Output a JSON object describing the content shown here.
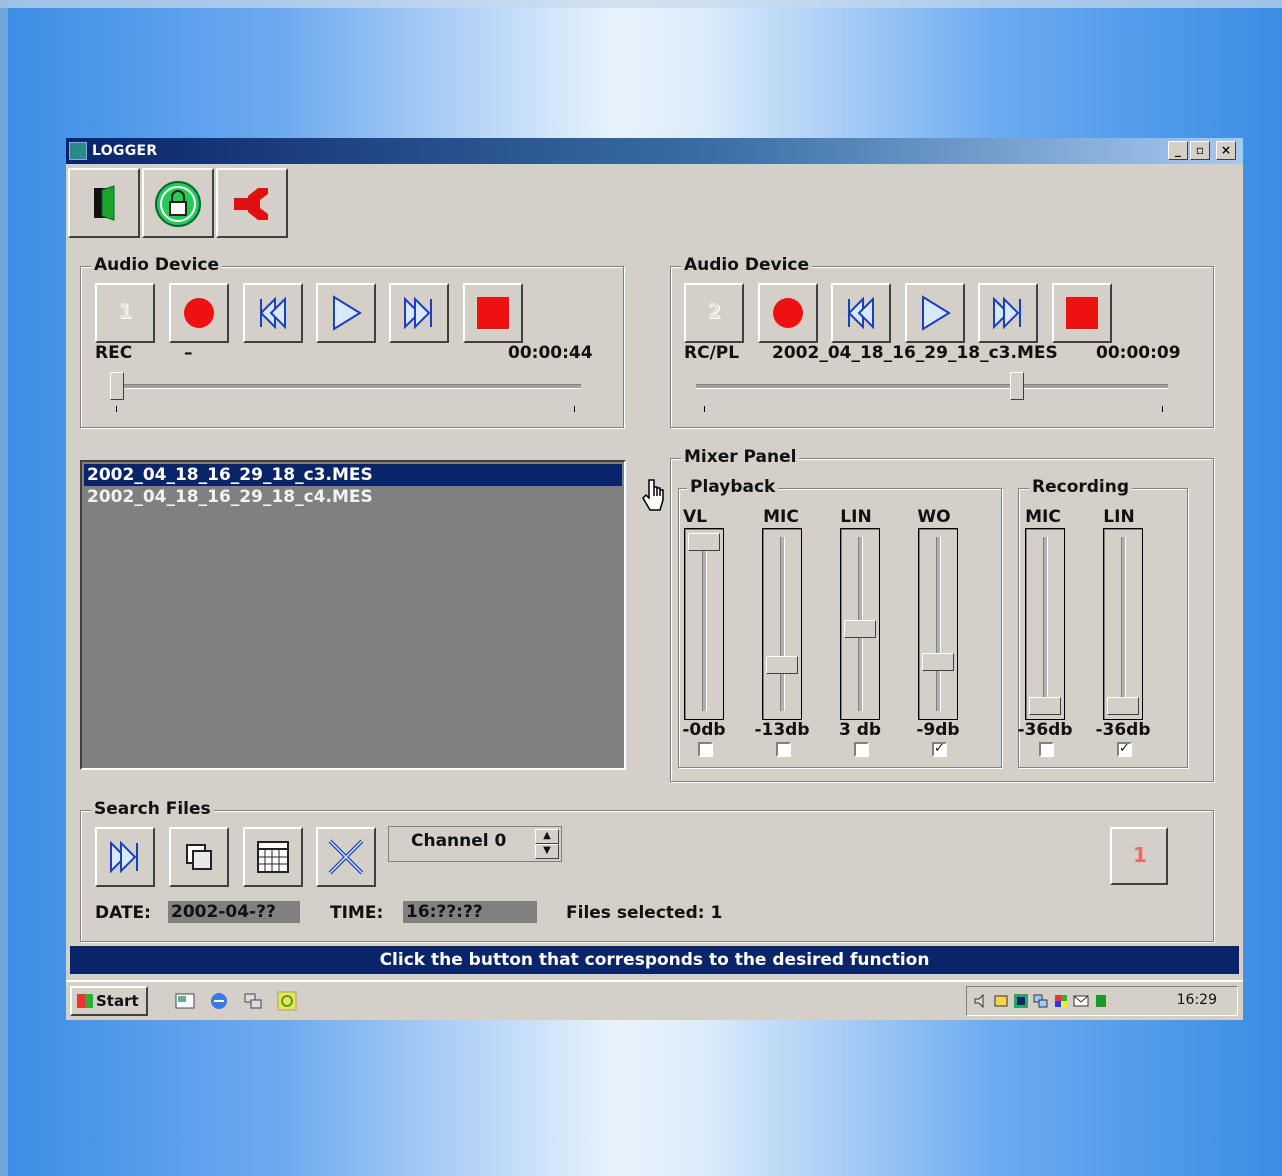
{
  "window": {
    "title": "LOGGER",
    "controls": {
      "minimize": "_",
      "maximize": "▫",
      "close": "×"
    }
  },
  "toolbar": {
    "icons": [
      "door-icon",
      "lock-icon",
      "disconnect-icon"
    ]
  },
  "audio_device_1": {
    "label": "Audio Device",
    "device_number": "1",
    "mode": "REC",
    "file": "–",
    "time": "00:00:44",
    "position": 0.0
  },
  "audio_device_2": {
    "label": "Audio Device",
    "device_number": "2",
    "mode": "RC/PL",
    "file": "2002_04_18_16_29_18_c3.MES",
    "time": "00:00:09",
    "position": 0.68
  },
  "file_list": {
    "items": [
      "2002_04_18_16_29_18_c3.MES",
      "2002_04_18_16_29_18_c4.MES"
    ],
    "selected_index": 0
  },
  "mixer": {
    "label": "Mixer Panel",
    "playback": {
      "label": "Playback",
      "channels": [
        {
          "name": "VL",
          "value": "-0db",
          "checked": false,
          "level": 1.0
        },
        {
          "name": "MIC",
          "value": "-13db",
          "checked": false,
          "level": 0.25
        },
        {
          "name": "LIN",
          "value": "3 db",
          "checked": false,
          "level": 0.47
        },
        {
          "name": "WO",
          "value": "-9db",
          "checked": true,
          "level": 0.27
        }
      ]
    },
    "recording": {
      "label": "Recording",
      "channels": [
        {
          "name": "MIC",
          "value": "-36db",
          "checked": false,
          "level": 0.0
        },
        {
          "name": "LIN",
          "value": "-36db",
          "checked": true,
          "level": 0.0
        }
      ]
    }
  },
  "search": {
    "label": "Search Files",
    "channel": "Channel  0",
    "right_button": "1",
    "date_label": "DATE:",
    "date_value": "2002-04-??",
    "time_label": "TIME:",
    "time_value": "16:??:??",
    "files_selected": "Files selected: 1"
  },
  "status": {
    "message": "Click the button that corresponds to the desired function"
  },
  "taskbar": {
    "start": "Start",
    "clock": "16:29"
  },
  "colors": {
    "face": "#d4d0c8",
    "title_blue": "#0a246a",
    "record_red": "#ee1111",
    "icon_blue": "#1a3fbf"
  }
}
